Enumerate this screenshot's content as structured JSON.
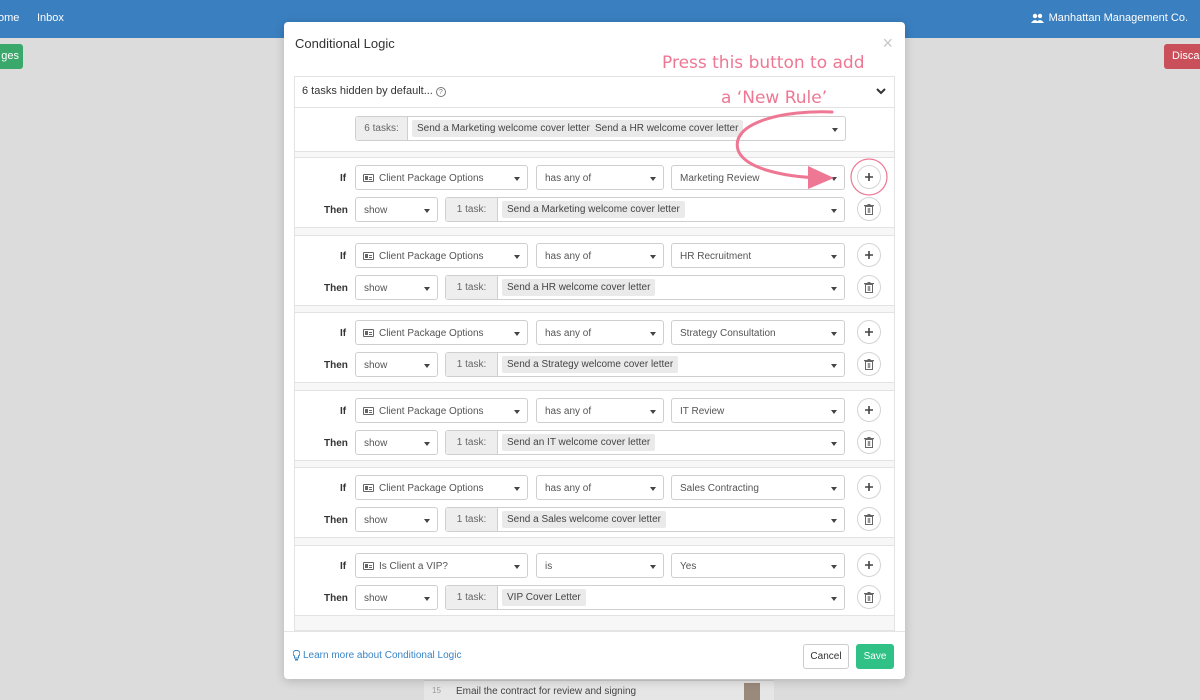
{
  "background": {
    "nav": [
      "ome",
      "Inbox"
    ],
    "org_name": "Manhattan Management Co.",
    "left_button": "ges",
    "right_button": "Disca",
    "row_number": "15",
    "row_text": "Email the contract for review and signing"
  },
  "modal": {
    "title": "Conditional Logic",
    "hidden_header": "6 tasks hidden by default...",
    "hidden_count": "6 tasks:",
    "hidden_tasks": [
      "Send a Marketing welcome cover letter",
      "Send a HR welcome cover letter"
    ],
    "if_label": "If",
    "then_label": "Then",
    "rules": [
      {
        "field": "Client Package Options",
        "op": "has any of",
        "value": "Marketing Review",
        "action": "show",
        "count": "1 task:",
        "task": "Send a Marketing welcome cover letter"
      },
      {
        "field": "Client Package Options",
        "op": "has any of",
        "value": "HR Recruitment",
        "action": "show",
        "count": "1 task:",
        "task": "Send a HR welcome cover letter"
      },
      {
        "field": "Client Package Options",
        "op": "has any of",
        "value": "Strategy Consultation",
        "action": "show",
        "count": "1 task:",
        "task": "Send a Strategy welcome cover letter"
      },
      {
        "field": "Client Package Options",
        "op": "has any of",
        "value": "IT Review",
        "action": "show",
        "count": "1 task:",
        "task": "Send an IT welcome cover letter"
      },
      {
        "field": "Client Package Options",
        "op": "has any of",
        "value": "Sales Contracting",
        "action": "show",
        "count": "1 task:",
        "task": "Send a Sales welcome cover letter"
      },
      {
        "field": "Is Client a VIP?",
        "op": "is",
        "value": "Yes",
        "action": "show",
        "count": "1 task:",
        "task": "VIP Cover Letter"
      }
    ],
    "learn_more": "Learn more about Conditional Logic",
    "cancel": "Cancel",
    "save": "Save"
  },
  "annotation": {
    "line1": "Press this button to add",
    "line2": "a ‘New Rule’",
    "color": "#ee7793"
  }
}
